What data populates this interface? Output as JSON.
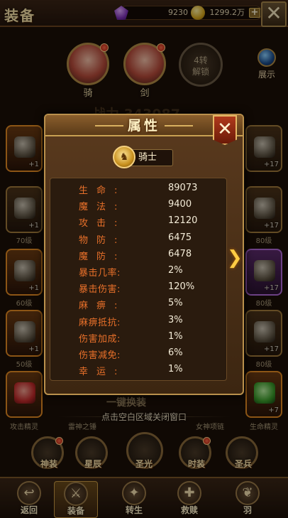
{
  "header": {
    "title": "装备",
    "gems": "9230",
    "gold": "1299.2万",
    "plus": "+"
  },
  "heroes": [
    {
      "label": "骑"
    },
    {
      "label": "剑"
    },
    {
      "label": "4转\n解锁"
    }
  ],
  "showcase_label": "展示",
  "power_text": "战力 343087",
  "slots_left": [
    {
      "lvl": "+1",
      "cap": ""
    },
    {
      "lvl": "+1",
      "cap": "70级"
    },
    {
      "lvl": "+1",
      "cap": "60级"
    },
    {
      "lvl": "+1",
      "cap": "50级"
    }
  ],
  "slots_right": [
    {
      "lvl": "+17",
      "cap": ""
    },
    {
      "lvl": "+17",
      "cap": "80级"
    },
    {
      "lvl": "+17",
      "cap": "80级"
    },
    {
      "lvl": "+17",
      "cap": "80级"
    }
  ],
  "bottom_slots": [
    {
      "lvl": "",
      "cap": "攻击精灵"
    },
    {
      "lvl": "",
      "cap": "雷神之锤"
    },
    {
      "lvl": "",
      "cap": "女神项链"
    },
    {
      "lvl": "+7",
      "cap": "生命精灵"
    }
  ],
  "one_click_label": "一键换装",
  "hint_text": "点击空白区域关闭窗口",
  "skills": [
    {
      "label": "神装"
    },
    {
      "label": "星辰"
    },
    {
      "label": "圣光"
    },
    {
      "label": "时装"
    },
    {
      "label": "圣兵"
    }
  ],
  "nav": [
    {
      "label": "返回",
      "icon": "↩"
    },
    {
      "label": "装备",
      "icon": "⚔"
    },
    {
      "label": "转生",
      "icon": "✦"
    },
    {
      "label": "救赎",
      "icon": "✚"
    },
    {
      "label": "羽",
      "icon": "❦"
    }
  ],
  "dialog": {
    "title": "属性",
    "close": "✕",
    "class_name": "骑士",
    "stats": [
      {
        "name": "生命:",
        "value": "89073",
        "wide": true
      },
      {
        "name": "魔法:",
        "value": "9400",
        "wide": true
      },
      {
        "name": "攻击:",
        "value": "12120",
        "wide": true
      },
      {
        "name": "物防:",
        "value": "6475",
        "wide": true
      },
      {
        "name": "魔防:",
        "value": "6478",
        "wide": true
      },
      {
        "name": "暴击几率:",
        "value": "2%",
        "wide": false
      },
      {
        "name": "暴击伤害:",
        "value": "120%",
        "wide": false
      },
      {
        "name": "麻痹:",
        "value": "5%",
        "wide": true
      },
      {
        "name": "麻痹抵抗:",
        "value": "3%",
        "wide": false
      },
      {
        "name": "伤害加成:",
        "value": "1%",
        "wide": false
      },
      {
        "name": "伤害减免:",
        "value": "6%",
        "wide": false
      },
      {
        "name": "幸运:",
        "value": "1%",
        "wide": true
      }
    ]
  },
  "colors": {
    "stat_name": "#e8702a",
    "stat_value": "#f4ecd8",
    "frame_gold": "#b9904c"
  }
}
